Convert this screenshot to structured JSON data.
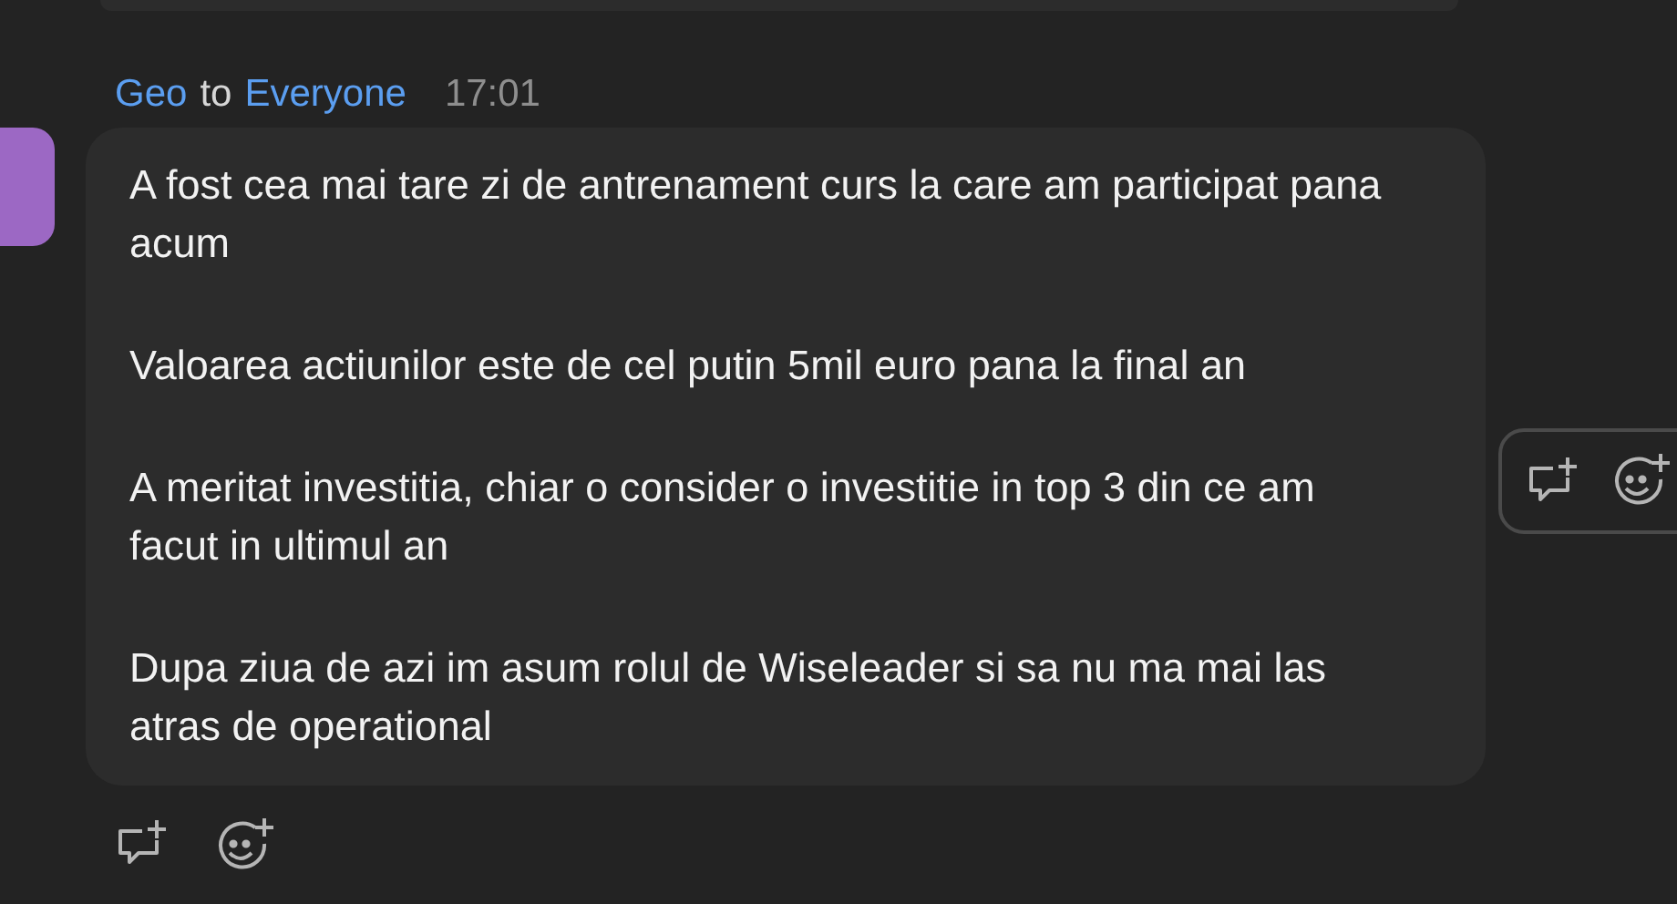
{
  "message": {
    "sender": "Geo",
    "connector": "to",
    "recipient": "Everyone",
    "time": "17:01",
    "paragraphs": [
      "A fost cea mai tare zi de antrenament curs la care am participat pana acum",
      "Valoarea actiunilor este de cel putin 5mil euro pana la final an",
      "A meritat investitia, chiar o consider o investitie in top 3 din ce am facut in ultimul an",
      "Dupa ziua de azi im asum rolul de Wiseleader si sa nu ma mai las atras de operational"
    ]
  }
}
